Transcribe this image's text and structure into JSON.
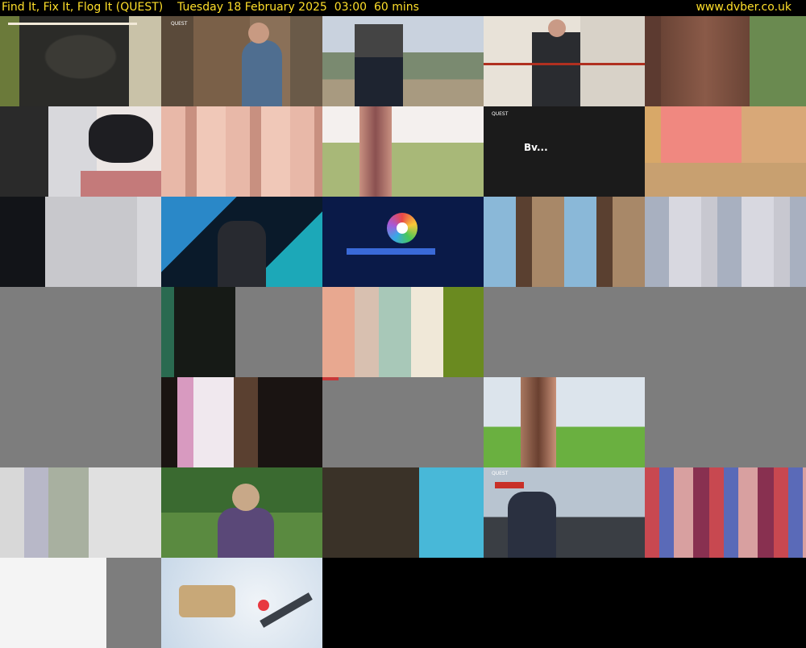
{
  "header": {
    "title": "Find It, Fix It, Flog It (QUEST)    Tuesday 18 February 2025  03:00  60 mins",
    "site": "www.dvber.co.uk"
  },
  "thumbnails": [
    {
      "label": "QUEST"
    },
    {
      "label": "Bv..."
    },
    {
      "label": "QUEST"
    },
    {
      "label": "QUEST"
    }
  ],
  "colors": {
    "header_text": "#ffdf2a",
    "gray_frame": "#7d7d7d"
  }
}
